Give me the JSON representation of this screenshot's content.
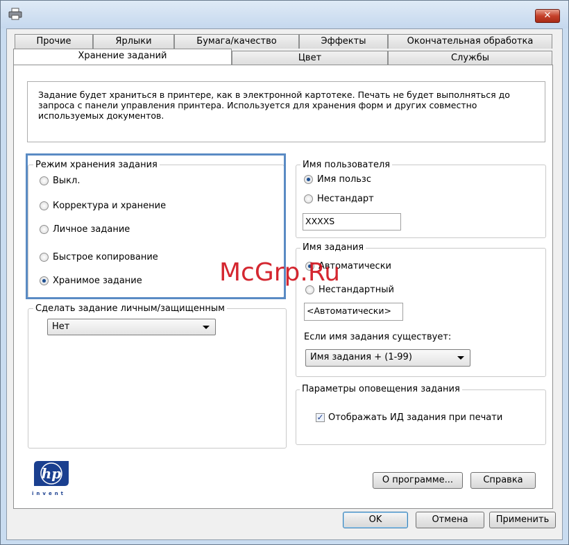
{
  "window": {
    "close_symbol": "✕",
    "app_icon": "printer-icon"
  },
  "tabs": {
    "row1": [
      "Прочие",
      "Ярлыки",
      "Бумага/качество",
      "Эффекты",
      "Окончательная обработка"
    ],
    "row2": [
      "Хранение заданий",
      "Цвет",
      "Службы"
    ],
    "active": "Хранение заданий"
  },
  "description": "Задание будет храниться в принтере, как в электронной картотеке. Печать не будет выполняться до запроса с панели управления принтера. Используется для хранения форм и других совместно используемых документов.",
  "job_storage_mode": {
    "legend": "Режим хранения задания",
    "options": [
      "Выкл.",
      "Корректура и хранение",
      "Личное задание",
      "Быстрое копирование",
      "Хранимое задание"
    ],
    "selected": "Хранимое задание"
  },
  "make_private": {
    "legend": "Сделать задание личным/защищенным",
    "value": "Нет"
  },
  "user_name": {
    "legend": "Имя пользователя",
    "options": [
      "Имя пользс",
      "Нестандарт"
    ],
    "selected": "Имя пользс",
    "value": "XXXXS"
  },
  "job_name": {
    "legend": "Имя задания",
    "options": [
      "Автоматически",
      "Нестандартный"
    ],
    "selected": "Автоматически",
    "value": "<Автоматически>",
    "exists_label": "Если имя задания существует:",
    "exists_value": "Имя задания + (1-99)"
  },
  "notification": {
    "legend": "Параметры оповещения задания",
    "checkbox_label": "Отображать ИД задания при печати",
    "checked": true
  },
  "logo": {
    "text": "hp",
    "tagline": "invent",
    "color": "#1a3f8f"
  },
  "buttons": {
    "about": "О программе...",
    "help": "Справка",
    "ok": "OK",
    "cancel": "Отмена",
    "apply": "Применить"
  },
  "watermark": "McGrp.Ru"
}
